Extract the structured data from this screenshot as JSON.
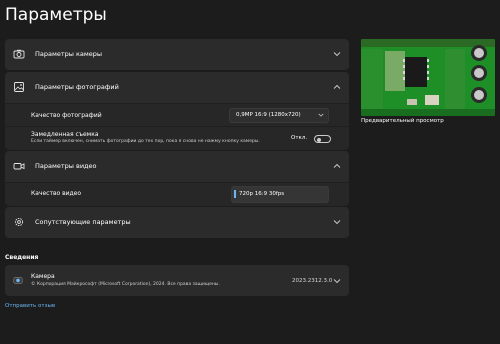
{
  "page_title": "Параметры",
  "sections": {
    "camera": {
      "label": "Параметры камеры"
    },
    "photo": {
      "label": "Параметры фотографий",
      "quality_label": "Качество фотографий",
      "quality_value": "0,9MP 16:9 (1280x720)",
      "timer_label": "Замедленная съемка",
      "timer_desc": "Если таймер включен, снимать фотографии до тех пор, пока я снова не нажму кнопку камеры.",
      "timer_state": "Откл."
    },
    "video": {
      "label": "Параметры видео",
      "quality_label": "Качество видео",
      "quality_value": "720p 16:9 30fps"
    },
    "related": {
      "label": "Сопутствующие параметры"
    }
  },
  "preview": {
    "label": "Предварительный просмотр"
  },
  "about": {
    "heading": "Сведения",
    "app_name": "Камера",
    "copyright": "© Корпорация Майкрософт (Microsoft Corporation), 2024. Все права защищены.",
    "version": "2023.2312.3.0"
  },
  "feedback_link": "Отправить отзыв",
  "icons": {
    "camera_section": "camera-icon",
    "photo_section": "image-icon",
    "video_section": "video-camera-icon",
    "related_section": "gear-icon",
    "about_app": "camera-app-icon"
  },
  "colors": {
    "accent": "#6cb8f6",
    "background": "#1c1c1c",
    "card": "#2b2b2b"
  }
}
